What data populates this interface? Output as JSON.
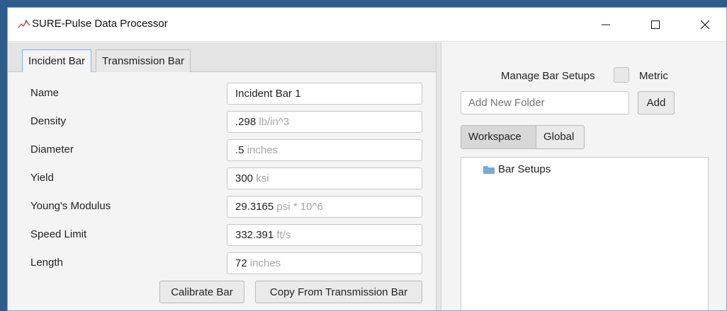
{
  "window": {
    "title": "SURE-Pulse Data Processor",
    "controls": {
      "minimize": "—",
      "maximize": "☐",
      "close": "✕"
    }
  },
  "tabs": [
    {
      "label": "Incident Bar",
      "active": true
    },
    {
      "label": "Transmission Bar",
      "active": false
    }
  ],
  "fields": {
    "name": {
      "label": "Name",
      "value": "Incident Bar 1",
      "unit": ""
    },
    "density": {
      "label": "Density",
      "value": ".298",
      "unit": "lb/in^3"
    },
    "diameter": {
      "label": "Diameter",
      "value": ".5",
      "unit": "inches"
    },
    "yield": {
      "label": "Yield",
      "value": "300",
      "unit": "ksi"
    },
    "youngs_modulus": {
      "label": "Young's Modulus",
      "value": "29.3165",
      "unit": "psi * 10^6"
    },
    "speed_limit": {
      "label": "Speed Limit",
      "value": "332.391",
      "unit": "ft/s"
    },
    "length": {
      "label": "Length",
      "value": "72",
      "unit": "inches"
    }
  },
  "buttons": {
    "calibrate": "Calibrate Bar",
    "copy": "Copy From Transmission Bar"
  },
  "right": {
    "manage_label": "Manage Bar Setups",
    "metric_label": "Metric",
    "metric_checked": false,
    "folder_placeholder": "Add New Folder",
    "add_button": "Add",
    "scope_tabs": [
      "Workspace",
      "Global"
    ],
    "tree": [
      {
        "label": "Bar Setups",
        "icon": "folder-icon"
      }
    ]
  },
  "colors": {
    "active_tab_border": "#7db4e6",
    "folder": "#7aa9d6",
    "unit_text": "#a7a7a7"
  }
}
